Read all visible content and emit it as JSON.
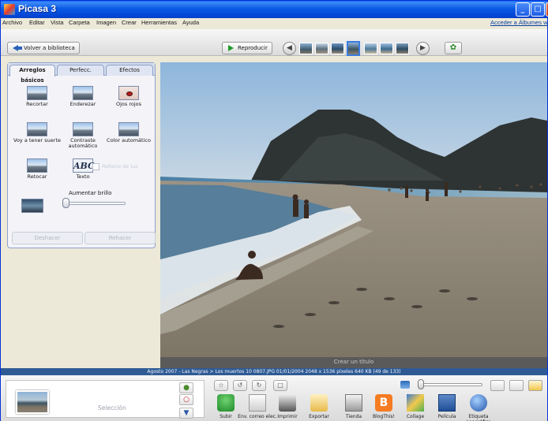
{
  "window": {
    "title": "Picasa 3"
  },
  "menu": {
    "items": [
      "Archivo",
      "Editar",
      "Vista",
      "Carpeta",
      "Imagen",
      "Crear",
      "Herramientas",
      "Ayuda"
    ],
    "web_link": "Acceder a Álbumes web"
  },
  "toolbar": {
    "back_label": "Volver a biblioteca",
    "play_label": "Reproducir",
    "thumbnail_count": 7,
    "selected_thumbnail": 4
  },
  "edit_panel": {
    "tabs": [
      "Arreglos básicos",
      "Perfecc.",
      "Efectos"
    ],
    "active_tab": 0,
    "tools": [
      {
        "label": "Recortar",
        "icon": "crop-icon"
      },
      {
        "label": "Enderezar",
        "icon": "straighten-icon"
      },
      {
        "label": "Ojos rojos",
        "icon": "red-eye-icon"
      },
      {
        "label": "Voy a tener suerte",
        "icon": "lucky-icon"
      },
      {
        "label": "Contraste automático",
        "icon": "auto-contrast-icon"
      },
      {
        "label": "Color automático",
        "icon": "auto-color-icon"
      },
      {
        "label": "Retocar",
        "icon": "retouch-icon"
      },
      {
        "label": "Texto",
        "icon": "text-icon",
        "icon_text": "ABC"
      }
    ],
    "disabled_tool_label": "Relleno de luz",
    "brightness_label": "Aumentar brillo",
    "brightness_level": 0,
    "undo_label": "Deshacer",
    "redo_label": "Rehacer"
  },
  "photo": {
    "caption_placeholder": "Crear un título",
    "scene": "beach with people and rocky cliffs"
  },
  "status": {
    "text": "Agosto 2007 - Las Negras > Los muertos 10 0807.JPG    01/01/2004    2048 x 1536 píxeles    640 KB    (49 de 133)"
  },
  "tray": {
    "selection_label": "Selección",
    "actions": [
      {
        "label": "Subir",
        "icon": "upload-icon"
      },
      {
        "label": "Env. correo elec.",
        "icon": "email-icon"
      },
      {
        "label": "Imprimir",
        "icon": "print-icon"
      },
      {
        "label": "Exportar",
        "icon": "export-icon"
      },
      {
        "label": "Tienda",
        "icon": "shop-icon"
      },
      {
        "label": "BlogThis!",
        "icon": "blogger-icon"
      },
      {
        "label": "Collage",
        "icon": "collage-icon"
      },
      {
        "label": "Película",
        "icon": "movie-icon"
      },
      {
        "label": "Etiqueta geográfica",
        "icon": "geotag-icon"
      }
    ]
  },
  "colors": {
    "titlebar": "#0a5be6",
    "status": "#2f5b95",
    "accent": "#3a7be0",
    "blogger": "#f57c22"
  }
}
